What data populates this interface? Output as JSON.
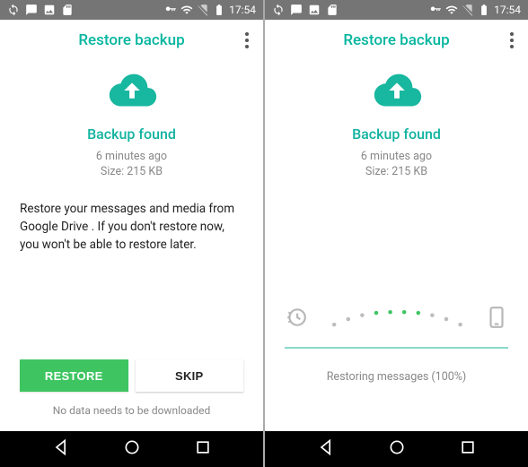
{
  "status": {
    "time": "17:54"
  },
  "header": {
    "title": "Restore backup"
  },
  "backup": {
    "found_label": "Backup found",
    "time_ago": "6 minutes ago",
    "size_label": "Size: 215 KB"
  },
  "left": {
    "description": "Restore your messages and media from Google Drive . If you don't restore now, you won't be able to restore later.",
    "restore_label": "RESTORE",
    "skip_label": "SKIP",
    "footnote": "No data needs to be downloaded"
  },
  "right": {
    "restoring_label": "Restoring messages (100%)"
  },
  "colors": {
    "accent": "#07b6a0",
    "primary_button": "#3ec561"
  }
}
